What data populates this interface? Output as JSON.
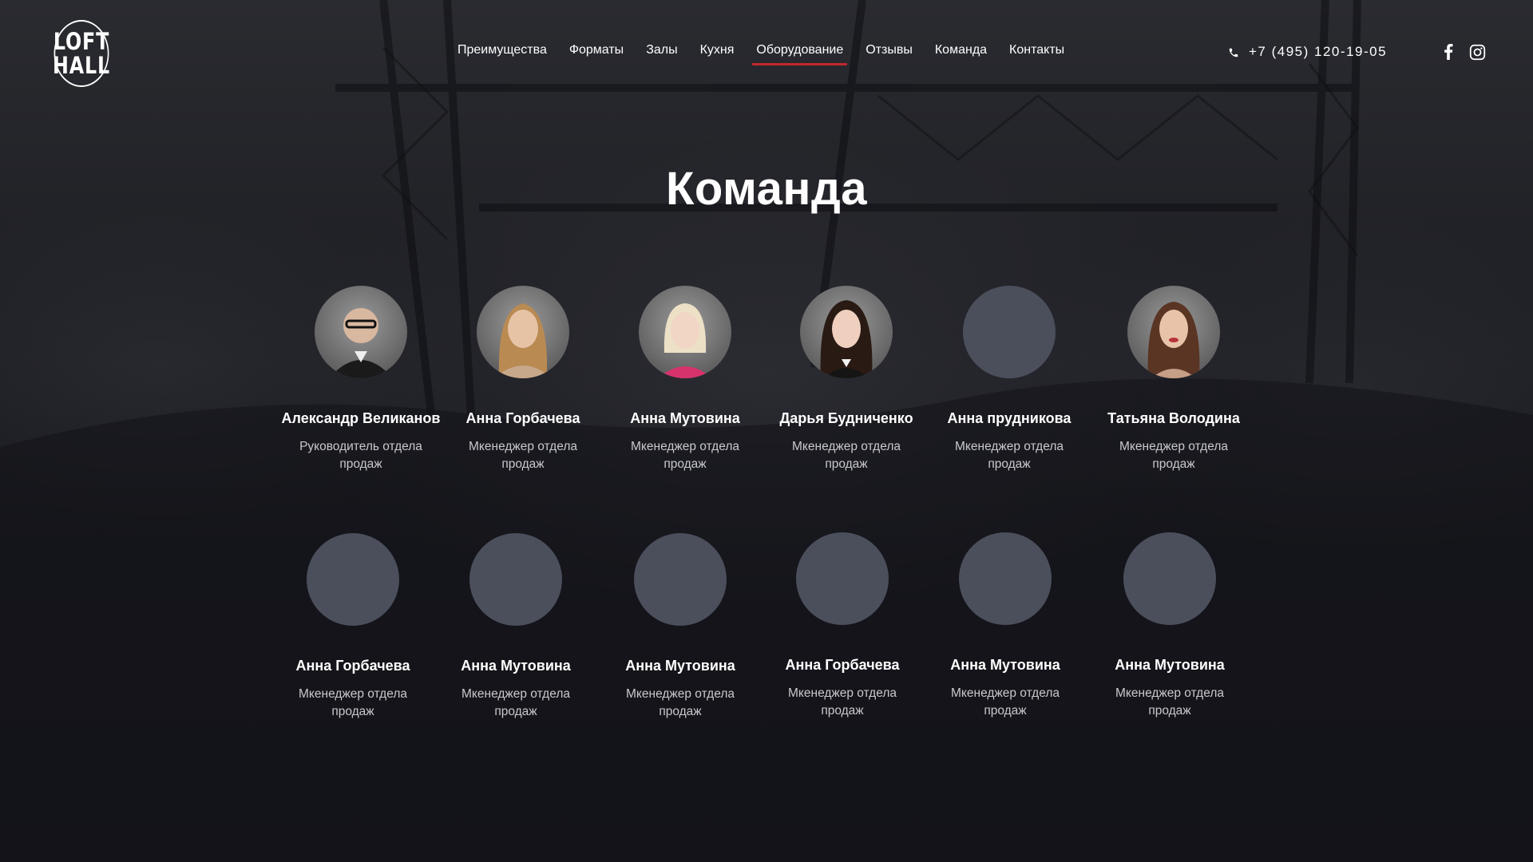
{
  "logo": {
    "line1": "LOFT",
    "line2": "HALL"
  },
  "nav": [
    {
      "label": "Преимущества",
      "active": false
    },
    {
      "label": "Форматы",
      "active": false
    },
    {
      "label": "Залы",
      "active": false
    },
    {
      "label": "Кухня",
      "active": false
    },
    {
      "label": "Оборудование",
      "active": true
    },
    {
      "label": "Отзывы",
      "active": false
    },
    {
      "label": "Команда",
      "active": false
    },
    {
      "label": "Контакты",
      "active": false
    }
  ],
  "phone": "+7 (495) 120-19-05",
  "icons": {
    "phone": "phone-icon",
    "facebook": "facebook-icon",
    "instagram": "instagram-icon"
  },
  "colors": {
    "accent": "#c1272d",
    "avatar_placeholder": "#4b4f5c"
  },
  "section_title": "Команда",
  "team": [
    {
      "name": "Александр Великанов",
      "role": "Руководитель отдела продаж",
      "photo": true
    },
    {
      "name": "Анна Горбачева",
      "role": "Мкенеджер отдела продаж",
      "photo": true
    },
    {
      "name": "Анна Мутовина",
      "role": "Мкенеджер отдела продаж",
      "photo": true
    },
    {
      "name": "Дарья Будниченко",
      "role": "Мкенеджер отдела продаж",
      "photo": true
    },
    {
      "name": "Анна прудникова",
      "role": "Мкенеджер отдела продаж",
      "photo": false
    },
    {
      "name": "Татьяна Володина",
      "role": "Мкенеджер отдела продаж",
      "photo": true
    },
    {
      "name": "Анна Горбачева",
      "role": "Мкенеджер отдела продаж",
      "photo": false
    },
    {
      "name": "Анна Мутовина",
      "role": "Мкенеджер отдела продаж",
      "photo": false
    },
    {
      "name": "Анна Мутовина",
      "role": "Мкенеджер отдела продаж",
      "photo": false
    },
    {
      "name": "Анна Горбачева",
      "role": "Мкенеджер отдела продаж",
      "photo": false
    },
    {
      "name": "Анна Мутовина",
      "role": "Мкенеджер отдела продаж",
      "photo": false
    },
    {
      "name": "Анна Мутовина",
      "role": "Мкенеджер отдела продаж",
      "photo": false
    }
  ]
}
